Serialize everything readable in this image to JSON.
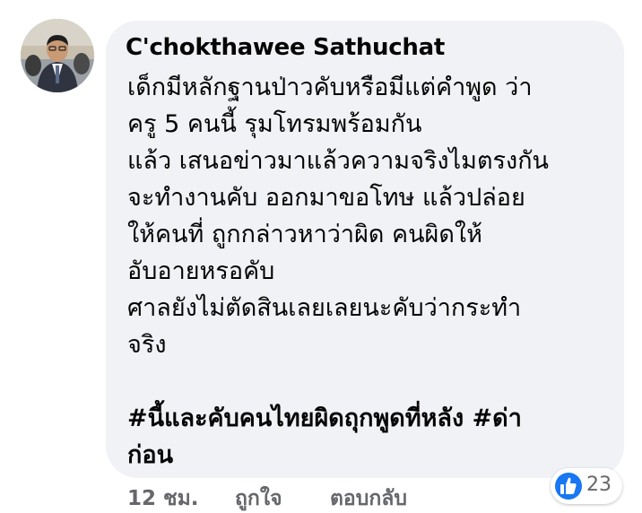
{
  "comment": {
    "author": "C'chokthawee Sathuchat",
    "lines": [
      "เด็กมีหลักฐานป่าวคับหรือมีแต่คำพูด ว่า",
      "ครู 5 คนนี้ รุมโทรมพร้อมกัน",
      "แล้ว เสนอข่าวมาแล้วความจริงไมตรงกัน",
      "จะทำงานคับ ออกมาขอโทษ แล้วปล่อย",
      "ให้คนที่ ถูกกล่าวหาว่าผิด คนผิดให้",
      "อับอายหรอคับ",
      " ศาลยังไม่ตัดสินเลยเลยนะคับว่ากระทำ",
      "จริง",
      "",
      "#นี้และคับคนไทยผิดถุกพูดที่หลัง #ด่า",
      "ก่อน"
    ]
  },
  "actions": {
    "time": "12 ชม.",
    "like": "ถูกใจ",
    "reply": "ตอบกลับ"
  },
  "reactions": {
    "icon": "thumbs-up-icon",
    "count": "23",
    "color": "#1877f2"
  },
  "colors": {
    "bubble": "#f0f2f5",
    "text": "#050505",
    "secondary": "#65676b"
  }
}
